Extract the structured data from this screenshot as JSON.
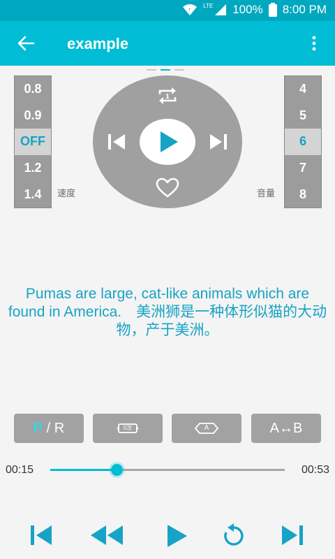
{
  "status_bar": {
    "network_type": "LTE",
    "battery": "100%",
    "time": "8:00 PM",
    "icons": [
      "wifi-icon",
      "signal-icon",
      "battery-icon"
    ]
  },
  "app_bar": {
    "title": "example",
    "icons": [
      "back-arrow-icon",
      "more-vert-icon"
    ],
    "background": "#00bcd4"
  },
  "pager": {
    "pages": 3,
    "active_index": 1
  },
  "speed": {
    "label": "速度",
    "options": [
      "0.8",
      "0.9",
      "OFF",
      "1.2",
      "1.4"
    ],
    "selected": "OFF"
  },
  "volume": {
    "label": "音量",
    "options": [
      "4",
      "5",
      "6",
      "7",
      "8"
    ],
    "selected": "6"
  },
  "dial": {
    "icons": [
      "repeat-one-icon",
      "skip-previous-icon",
      "play-icon",
      "skip-next-icon",
      "heart-outline-icon"
    ]
  },
  "lyric": {
    "text": "Pumas are large, cat-like animals which are found in America.　美洲狮是一种体形似猫的大动物，产于美洲。"
  },
  "mode_buttons": [
    {
      "label_accent": "P",
      "label_rest": " / R"
    },
    {
      "icon": "repeat-count-icon",
      "badge": "0次"
    },
    {
      "icon": "single-a-icon",
      "badge": "A"
    },
    {
      "label": "A↔B"
    }
  ],
  "progress": {
    "current": "00:15",
    "total": "00:53",
    "fraction": 0.283
  },
  "transport": {
    "icons": [
      "skip-previous-icon",
      "rewind-icon",
      "play-icon",
      "replay-icon",
      "skip-next-icon"
    ]
  },
  "colors": {
    "accent": "#00bcd4",
    "status_bar": "#00a8bf",
    "lyric": "#17a3c5",
    "control_gray": "#a0a0a0"
  }
}
